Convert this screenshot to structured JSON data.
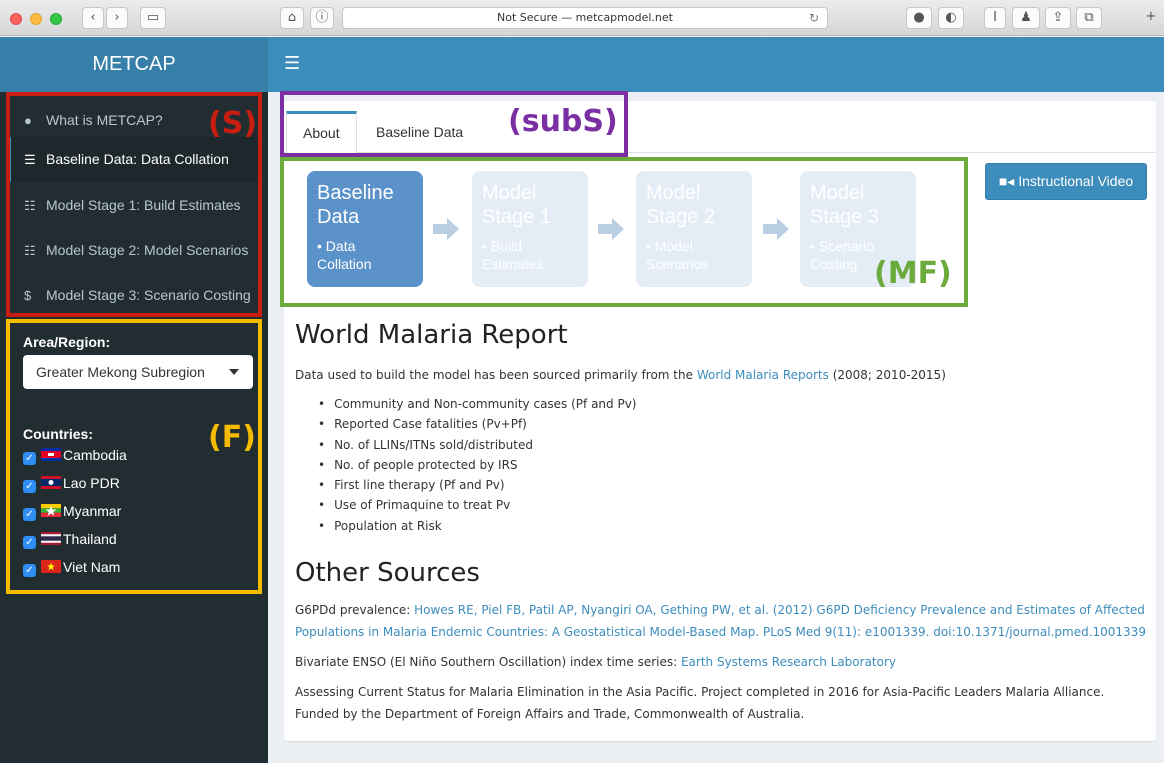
{
  "browser": {
    "url_text": "Not Secure — metcapmodel.net",
    "reload_icon": "reload-icon"
  },
  "header": {
    "logo": "METCAP",
    "menu_icon": "hamburger-icon"
  },
  "sidebar": {
    "items": [
      {
        "label": "What is METCAP?",
        "icon": "info-icon",
        "active": false
      },
      {
        "label": "Baseline Data: Data Collation",
        "icon": "database-icon",
        "active": true
      },
      {
        "label": "Model Stage 1: Build Estimates",
        "icon": "sliders-icon",
        "active": false
      },
      {
        "label": "Model Stage 2: Model Scenarios",
        "icon": "sliders-icon",
        "active": false
      },
      {
        "label": "Model Stage 3: Scenario Costing",
        "icon": "dollar-icon",
        "active": false
      }
    ],
    "area_label": "Area/Region:",
    "area_value": "Greater Mekong Subregion",
    "countries_label": "Countries:",
    "countries": [
      {
        "name": "Cambodia",
        "checked": true
      },
      {
        "name": "Lao PDR",
        "checked": true
      },
      {
        "name": "Myanmar",
        "checked": true
      },
      {
        "name": "Thailand",
        "checked": true
      },
      {
        "name": "Viet Nam",
        "checked": true
      }
    ]
  },
  "annotations": {
    "S": "(S)",
    "F": "(F)",
    "subS": "(subS)",
    "MF": "(MF)",
    "colors": {
      "S": "#c81d11",
      "F": "#f5bb00",
      "subS": "#7b2fa3",
      "MF": "#6aab3c"
    }
  },
  "tabs": [
    {
      "label": "About",
      "active": true
    },
    {
      "label": "Baseline Data",
      "active": false
    }
  ],
  "flow": [
    {
      "title": "Baseline Data",
      "desc": "• Data Collation",
      "active": true
    },
    {
      "title": "Model Stage 1",
      "desc": "• Build Estimates",
      "active": false
    },
    {
      "title": "Model Stage 2",
      "desc": "• Model Scenarios",
      "active": false
    },
    {
      "title": "Model Stage 3",
      "desc": "• Scenario Costing",
      "active": false
    }
  ],
  "video_button": "Instructional Video",
  "report": {
    "heading": "World Malaria Report",
    "intro_before": "Data used to build the model has been sourced primarily from the ",
    "intro_link": "World Malaria Reports",
    "intro_after": " (2008; 2010-2015)",
    "bullets": [
      "Community and Non-community cases (Pf and Pv)",
      "Reported Case fatalities (Pv+Pf)",
      "No. of LLINs/ITNs sold/distributed",
      "No. of people protected by IRS",
      "First line therapy (Pf and Pv)",
      "Use of Primaquine to treat Pv",
      "Population at Risk"
    ]
  },
  "other": {
    "heading": "Other Sources",
    "g6pd_label": "G6PDd prevalence: ",
    "g6pd_link_line1": "Howes RE, Piel FB, Patil AP, Nyangiri OA, Gething PW, et al. (2012) G6PD Deficiency Prevalence and Estimates of Affected",
    "g6pd_link_line2": "Populations in Malaria Endemic Countries: A Geostatistical Model-Based Map. PLoS Med 9(11): e1001339. doi:10.1371/journal.pmed.1001339",
    "enso_label": "Bivariate ENSO (El Niño Southern Oscillation) index time series: ",
    "enso_link": "Earth Systems Research Laboratory",
    "footer_line1": "Assessing Current Status for Malaria Elimination in the Asia Pacific. Project completed in 2016 for Asia-Pacific Leaders Malaria Alliance.",
    "footer_line2": "Funded by the Department of Foreign Affairs and Trade, Commonwealth of Australia."
  }
}
